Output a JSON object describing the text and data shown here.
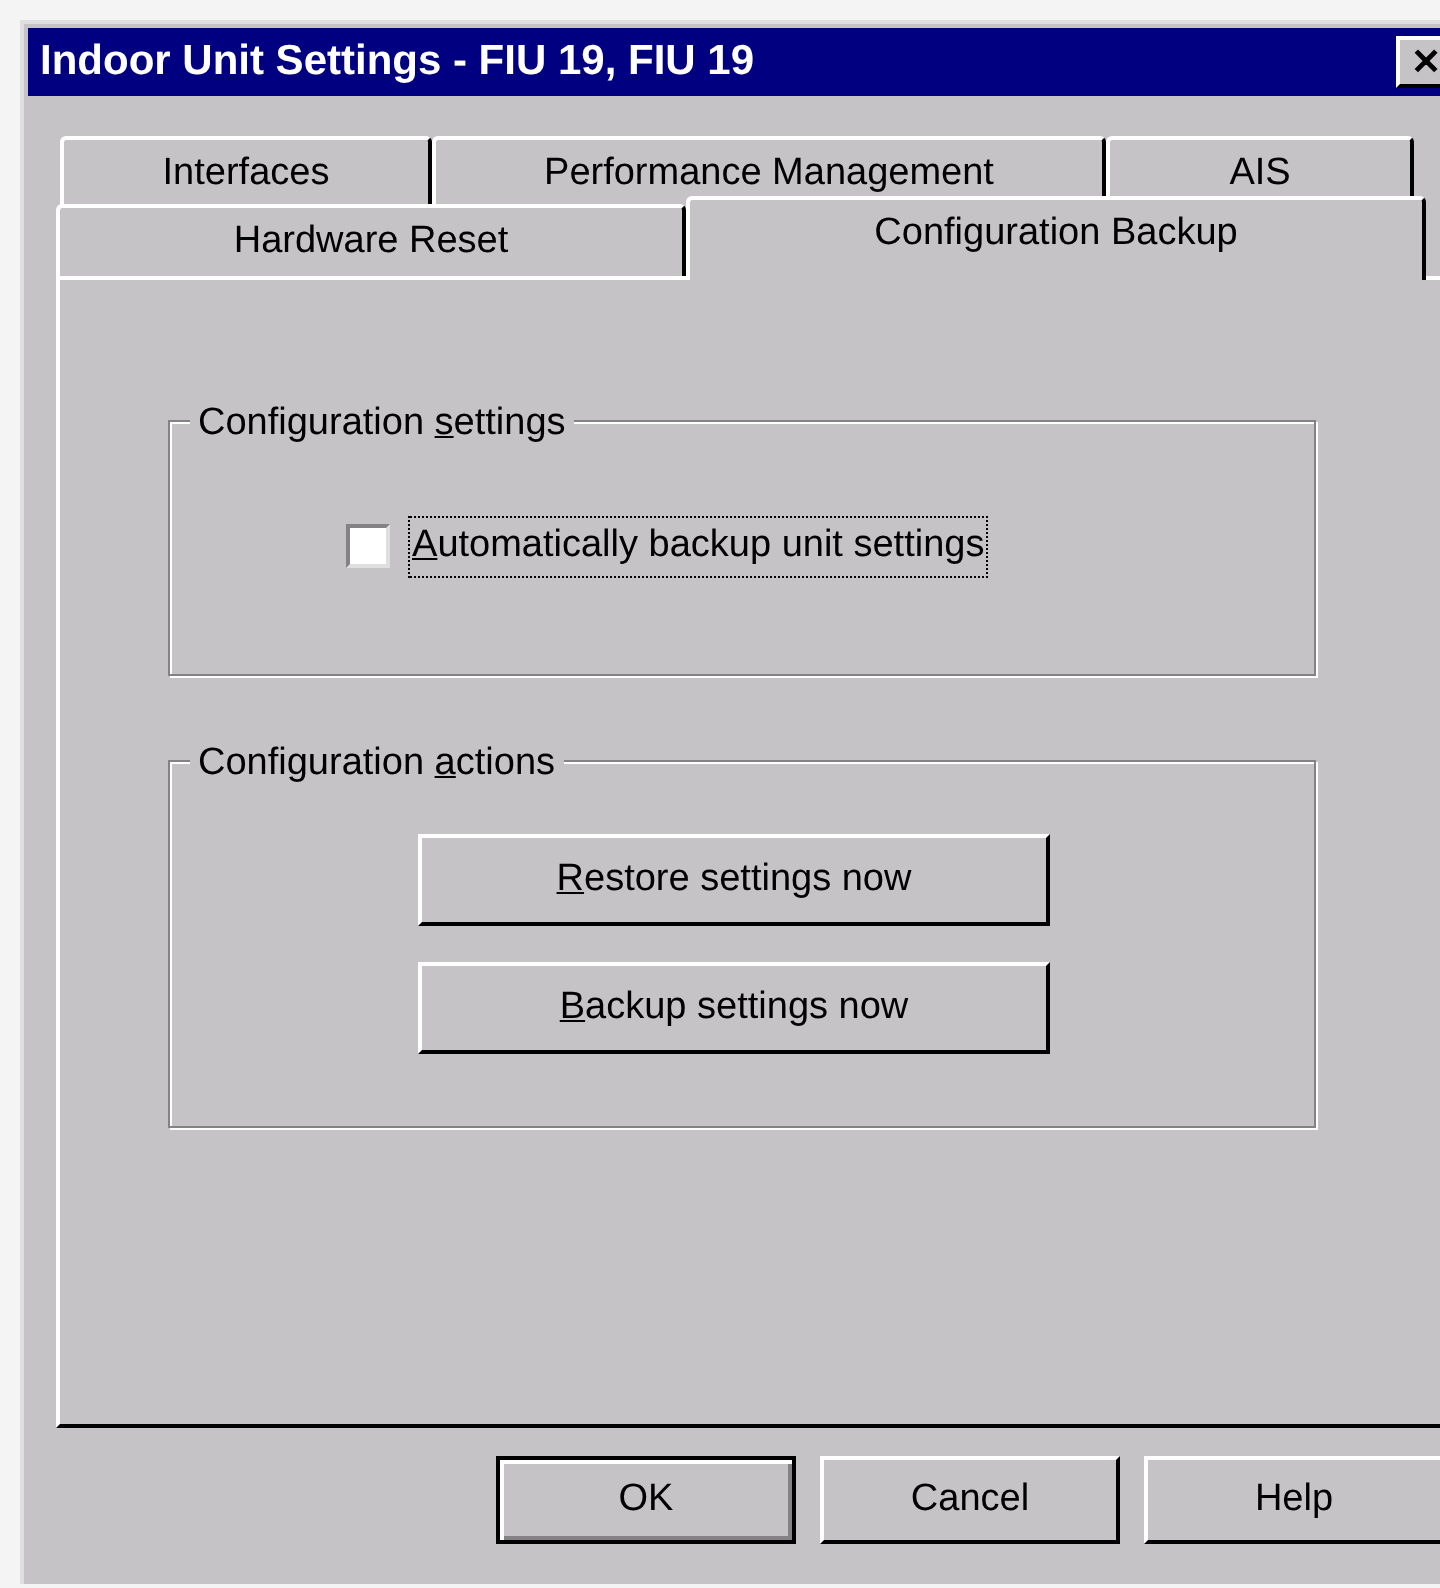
{
  "window": {
    "title": "Indoor Unit Settings - FIU 19, FIU 19",
    "close": "✕"
  },
  "tab_rows": [
    {
      "tabs": [
        {
          "label": "Interfaces",
          "selected": false
        },
        {
          "label": "Performance Management",
          "selected": false
        },
        {
          "label": "AIS",
          "selected": false
        }
      ]
    },
    {
      "tabs": [
        {
          "label": "Hardware Reset",
          "selected": false
        },
        {
          "label": "Configuration Backup",
          "selected": true
        }
      ]
    }
  ],
  "groups": [
    {
      "kind": "settings",
      "label_parts": {
        "before": "Configuration ",
        "key": "s",
        "after": "ettings"
      },
      "checkbox": {
        "label_parts": {
          "key": "A",
          "after": "utomatically backup unit settings"
        },
        "checked": false,
        "focused": true
      }
    },
    {
      "kind": "actions",
      "label_parts": {
        "before": "Configuration ",
        "key": "a",
        "after": "ctions"
      },
      "buttons": [
        {
          "label_parts": {
            "key": "R",
            "after": "estore settings now"
          }
        },
        {
          "label_parts": {
            "key": "B",
            "after": "ackup settings now"
          }
        }
      ]
    }
  ],
  "buttons": [
    {
      "label": "OK",
      "default": true
    },
    {
      "label": "Cancel",
      "default": false
    },
    {
      "label": "Help",
      "default": false
    }
  ]
}
